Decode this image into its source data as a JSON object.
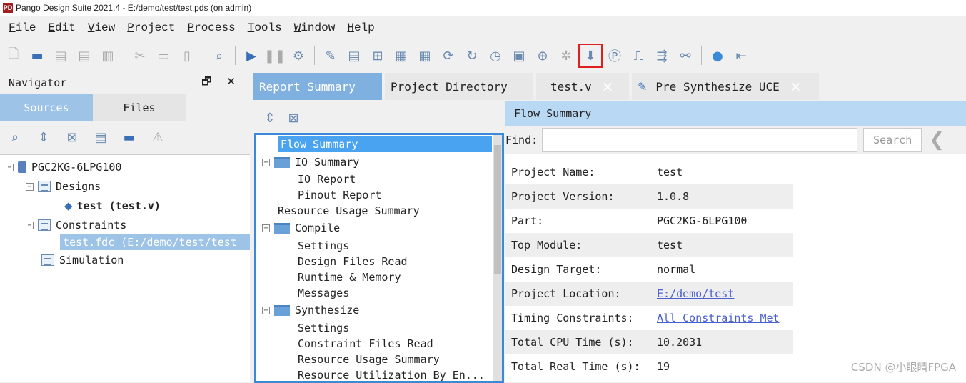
{
  "window": {
    "title": "Pango Design Suite 2021.4 - E:/demo/test/test.pds (on admin)",
    "logo": "PD"
  },
  "menu": [
    "File",
    "Edit",
    "View",
    "Project",
    "Process",
    "Tools",
    "Window",
    "Help"
  ],
  "navigator": {
    "title": "Navigator",
    "float": "🗗",
    "close": "✕",
    "tabs": {
      "sources": "Sources",
      "files": "Files"
    },
    "tree": {
      "device": "PGC2KG-6LPG100",
      "designs": "Designs",
      "top": "test (test.v)",
      "constraints": "Constraints",
      "fdc": "test.fdc (E:/demo/test/test",
      "simulation": "Simulation"
    }
  },
  "tabs": {
    "report": "Report Summary",
    "projdir": "Project Directory",
    "testv": "test.v",
    "uce": "Pre Synthesize UCE",
    "close": "×"
  },
  "report_tree": {
    "flow": "Flow Summary",
    "io": "IO Summary",
    "io_report": "IO Report",
    "pinout": "Pinout Report",
    "resource": "Resource Usage Summary",
    "compile": "Compile",
    "settings": "Settings",
    "design_files": "Design Files Read",
    "runtime": "Runtime & Memory",
    "messages": "Messages",
    "synth": "Synthesize",
    "s_settings": "Settings",
    "constraint_files": "Constraint Files Read",
    "s_resource": "Resource Usage Summary",
    "utilization": "Resource Utilization By En..."
  },
  "main": {
    "header": "Flow Summary",
    "find_label": "Find:",
    "search": "Search",
    "rows": [
      {
        "k": "Project Name:",
        "v": "test"
      },
      {
        "k": "Project Version:",
        "v": "1.0.8"
      },
      {
        "k": "Part:",
        "v": "PGC2KG-6LPG100"
      },
      {
        "k": "Top Module:",
        "v": "test"
      },
      {
        "k": "Design Target:",
        "v": "normal"
      },
      {
        "k": "Project Location:",
        "v": "E:/demo/test"
      },
      {
        "k": "Timing Constraints:",
        "v": "All Constraints Met"
      },
      {
        "k": "Total CPU Time (s):",
        "v": "10.2031"
      },
      {
        "k": "Total Real Time (s):",
        "v": "19"
      }
    ]
  },
  "watermark": "CSDN @小眼睛FPGA",
  "colors": {
    "accent": "#7fb0e0",
    "highlight_border": "#e02020",
    "selected": "#4aa3f0"
  }
}
